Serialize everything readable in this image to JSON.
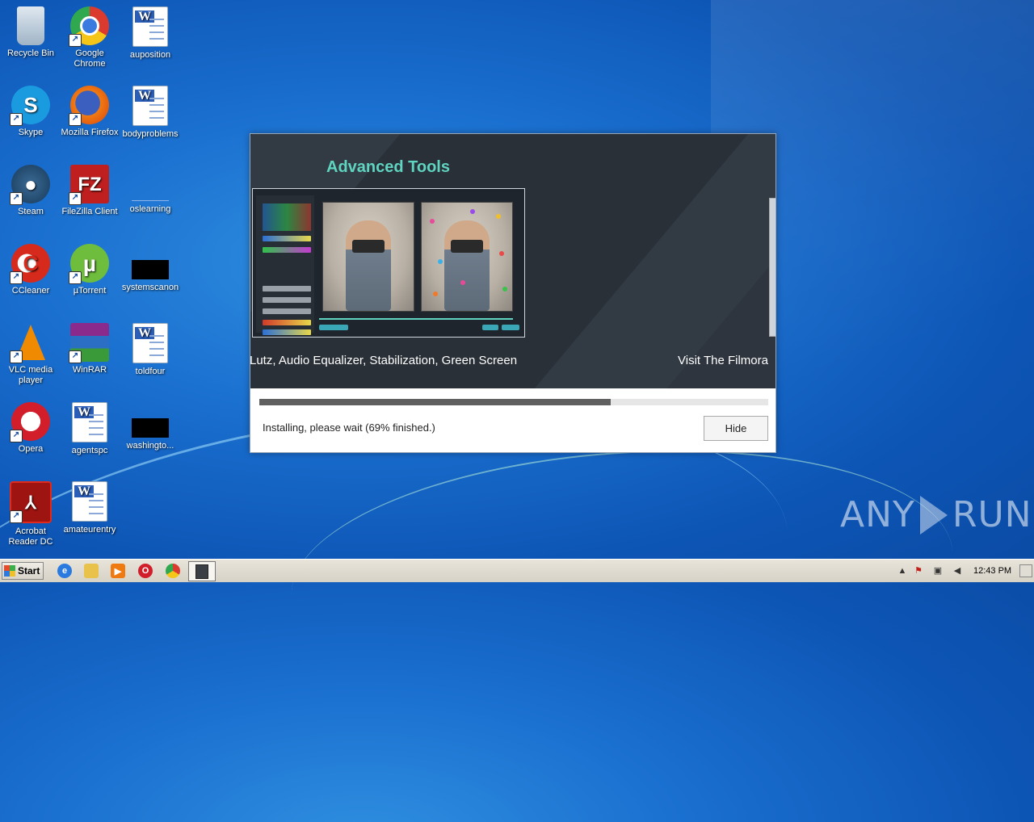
{
  "desktop": {
    "icons": [
      {
        "label": "Recycle Bin",
        "icon": "recycle-bin-icon"
      },
      {
        "label": "Google Chrome",
        "icon": "chrome-icon"
      },
      {
        "label": "auposition",
        "icon": "word-doc-icon"
      },
      {
        "label": "Skype",
        "icon": "skype-icon"
      },
      {
        "label": "Mozilla Firefox",
        "icon": "firefox-icon"
      },
      {
        "label": "bodyproblems",
        "icon": "word-doc-icon"
      },
      {
        "label": "Steam",
        "icon": "steam-icon"
      },
      {
        "label": "FileZilla Client",
        "icon": "filezilla-icon"
      },
      {
        "label": "oslearning",
        "icon": "blank-file-icon"
      },
      {
        "label": "CCleaner",
        "icon": "ccleaner-icon"
      },
      {
        "label": "µTorrent",
        "icon": "utorrent-icon"
      },
      {
        "label": "systemscanon",
        "icon": "black-thumbnail-icon"
      },
      {
        "label": "VLC media player",
        "icon": "vlc-icon"
      },
      {
        "label": "WinRAR",
        "icon": "winrar-icon"
      },
      {
        "label": "toldfour",
        "icon": "word-doc-icon"
      },
      {
        "label": "Opera",
        "icon": "opera-icon"
      },
      {
        "label": "agentspc",
        "icon": "word-doc-icon"
      },
      {
        "label": "washingto...",
        "icon": "black-thumbnail-icon"
      },
      {
        "label": "Acrobat Reader DC",
        "icon": "acrobat-icon"
      },
      {
        "label": "amateurentry",
        "icon": "word-doc-icon"
      }
    ]
  },
  "installer": {
    "banner_title": "Advanced Tools",
    "caption_main": "Lutz, Audio Equalizer, Stabilization, Green Screen",
    "caption_next": "Visit The Filmora",
    "progress_percent": 69,
    "status_text": "Installing, please wait (69% finished.)",
    "hide_label": "Hide",
    "accent_color": "#5fd4c0"
  },
  "taskbar": {
    "start_label": "Start",
    "pinned": [
      "internet-explorer-icon",
      "explorer-folder-icon",
      "media-player-icon",
      "opera-icon",
      "chrome-icon",
      "installer-app-icon"
    ],
    "clock": "12:43 PM"
  },
  "watermark": {
    "left": "ANY",
    "right": "RUN"
  }
}
